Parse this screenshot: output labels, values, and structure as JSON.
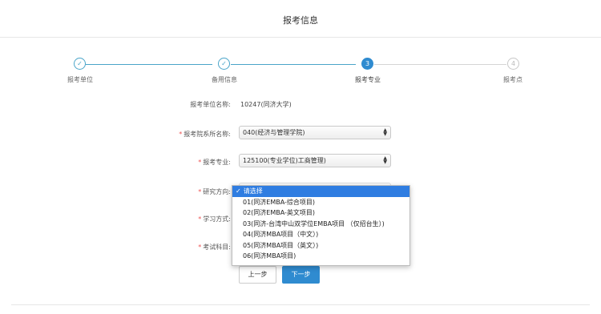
{
  "header": {
    "title": "报考信息"
  },
  "steps": [
    {
      "label": "报考单位",
      "marker": "✓"
    },
    {
      "label": "备用信息",
      "marker": "✓"
    },
    {
      "label": "报考专业",
      "marker": "3"
    },
    {
      "label": "报考点",
      "marker": "4"
    }
  ],
  "form": {
    "unit": {
      "label": "报考单位名称:",
      "value": "10247(同济大学)"
    },
    "department": {
      "label": "报考院系所名称:",
      "value": "040(经济与管理学院)"
    },
    "major": {
      "label": "报考专业:",
      "value": "125100(专业学位)工商管理)"
    },
    "direction": {
      "label": "研究方向:"
    },
    "study_mode": {
      "label": "学习方式:"
    },
    "exam_subject": {
      "label": "考试科目:"
    }
  },
  "dropdown": {
    "options": [
      "请选择",
      "01(同济EMBA-综合项目)",
      "02(同济EMBA-英文项目)",
      "03(同济-台湾中山双学位EMBA项目 （仅招台生）)",
      "04(同济MBA项目（中文）)",
      "05(同济MBA项目（英文）)",
      "06(同济MBA项目)"
    ],
    "selected_index": 0
  },
  "buttons": {
    "prev": "上一步",
    "next": "下一步"
  },
  "colors": {
    "accent": "#2f8bd0",
    "done": "#4aa5c9",
    "required": "#e55555"
  }
}
